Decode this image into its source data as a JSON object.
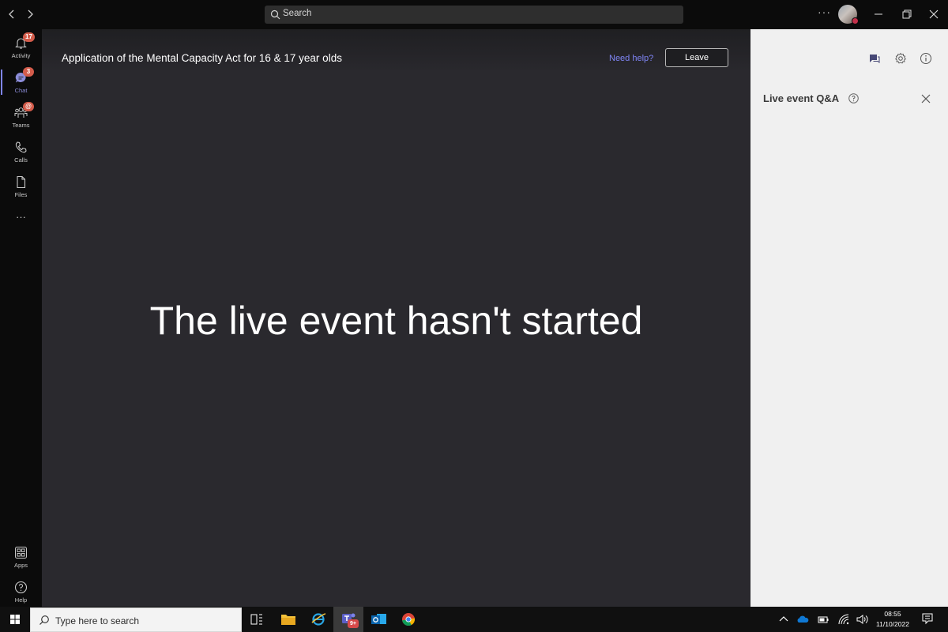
{
  "titlebar": {
    "search_placeholder": "Search",
    "more_label": "···"
  },
  "rail": {
    "items": [
      {
        "label": "Activity",
        "badge": "17"
      },
      {
        "label": "Chat",
        "badge": "3"
      },
      {
        "label": "Teams",
        "badge": "@"
      },
      {
        "label": "Calls"
      },
      {
        "label": "Files"
      }
    ],
    "more_label": "···",
    "bottom_items": [
      {
        "label": "Apps"
      },
      {
        "label": "Help"
      }
    ]
  },
  "main": {
    "event_title": "Application of the Mental Capacity Act for 16 & 17 year olds",
    "need_help": "Need help?",
    "leave_label": "Leave",
    "status_message": "The live event hasn't started"
  },
  "qa_panel": {
    "title": "Live event Q&A"
  },
  "taskbar": {
    "search_placeholder": "Type here to search",
    "teams_badge": "9+",
    "time": "08:55",
    "date": "11/10/2022"
  },
  "colors": {
    "accent": "#7f85f5",
    "main_bg": "#2a292e",
    "panel_bg": "#f0f0f0",
    "badge": "#d35c4b"
  }
}
